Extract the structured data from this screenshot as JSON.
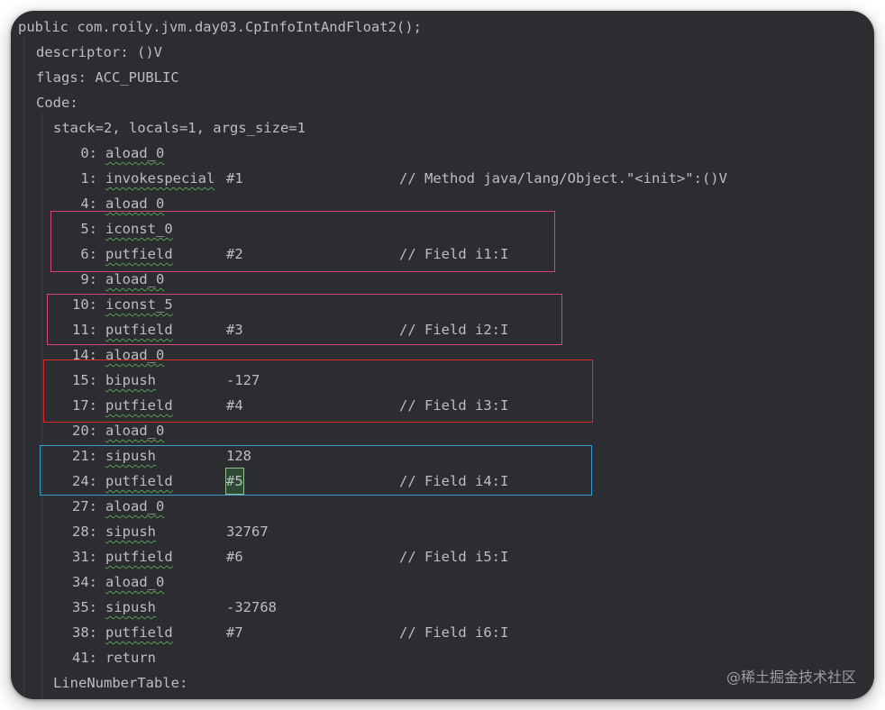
{
  "header": {
    "signature": "public com.roily.jvm.day03.CpInfoIntAndFloat2();",
    "descriptor": "descriptor: ()V",
    "flags": "flags: ACC_PUBLIC",
    "code_label": "Code:",
    "stack_info": "stack=2, locals=1, args_size=1"
  },
  "instructions": [
    {
      "offset": "0:",
      "op": "aload_0",
      "arg": "",
      "comment": ""
    },
    {
      "offset": "1:",
      "op": "invokespecial",
      "arg": "#1",
      "comment": "// Method java/lang/Object.\"<init>\":()V"
    },
    {
      "offset": "4:",
      "op": "aload_0",
      "arg": "",
      "comment": ""
    },
    {
      "offset": "5:",
      "op": "iconst_0",
      "arg": "",
      "comment": ""
    },
    {
      "offset": "6:",
      "op": "putfield",
      "arg": "#2",
      "comment": "// Field i1:I"
    },
    {
      "offset": "9:",
      "op": "aload_0",
      "arg": "",
      "comment": ""
    },
    {
      "offset": "10:",
      "op": "iconst_5",
      "arg": "",
      "comment": ""
    },
    {
      "offset": "11:",
      "op": "putfield",
      "arg": "#3",
      "comment": "// Field i2:I"
    },
    {
      "offset": "14:",
      "op": "aload_0",
      "arg": "",
      "comment": ""
    },
    {
      "offset": "15:",
      "op": "bipush",
      "arg": "-127",
      "comment": ""
    },
    {
      "offset": "17:",
      "op": "putfield",
      "arg": "#4",
      "comment": "// Field i3:I"
    },
    {
      "offset": "20:",
      "op": "aload_0",
      "arg": "",
      "comment": ""
    },
    {
      "offset": "21:",
      "op": "sipush",
      "arg": "128",
      "comment": ""
    },
    {
      "offset": "24:",
      "op": "putfield",
      "arg": "#5",
      "comment": "// Field i4:I",
      "highlight_arg": true
    },
    {
      "offset": "27:",
      "op": "aload_0",
      "arg": "",
      "comment": ""
    },
    {
      "offset": "28:",
      "op": "sipush",
      "arg": "32767",
      "comment": ""
    },
    {
      "offset": "31:",
      "op": "putfield",
      "arg": "#6",
      "comment": "// Field i5:I"
    },
    {
      "offset": "34:",
      "op": "aload_0",
      "arg": "",
      "comment": ""
    },
    {
      "offset": "35:",
      "op": "sipush",
      "arg": "-32768",
      "comment": ""
    },
    {
      "offset": "38:",
      "op": "putfield",
      "arg": "#7",
      "comment": "// Field i6:I"
    },
    {
      "offset": "41:",
      "op": "return",
      "arg": "",
      "comment": "",
      "no_wavy": true
    }
  ],
  "footer": {
    "line_number_table": "LineNumberTable:"
  },
  "annotation_boxes": [
    {
      "name": "iconst-0-box",
      "color": "#d6457a"
    },
    {
      "name": "iconst-5-box",
      "color": "#d6457a"
    },
    {
      "name": "bipush-box",
      "color": "#e0262b"
    },
    {
      "name": "sipush-128-box",
      "color": "#3a9ccf"
    }
  ],
  "watermark": "@稀土掘金技术社区",
  "colors": {
    "background": "#2b2d30",
    "text": "#bcbec4",
    "wavy_underline": "#5a9c5a"
  }
}
